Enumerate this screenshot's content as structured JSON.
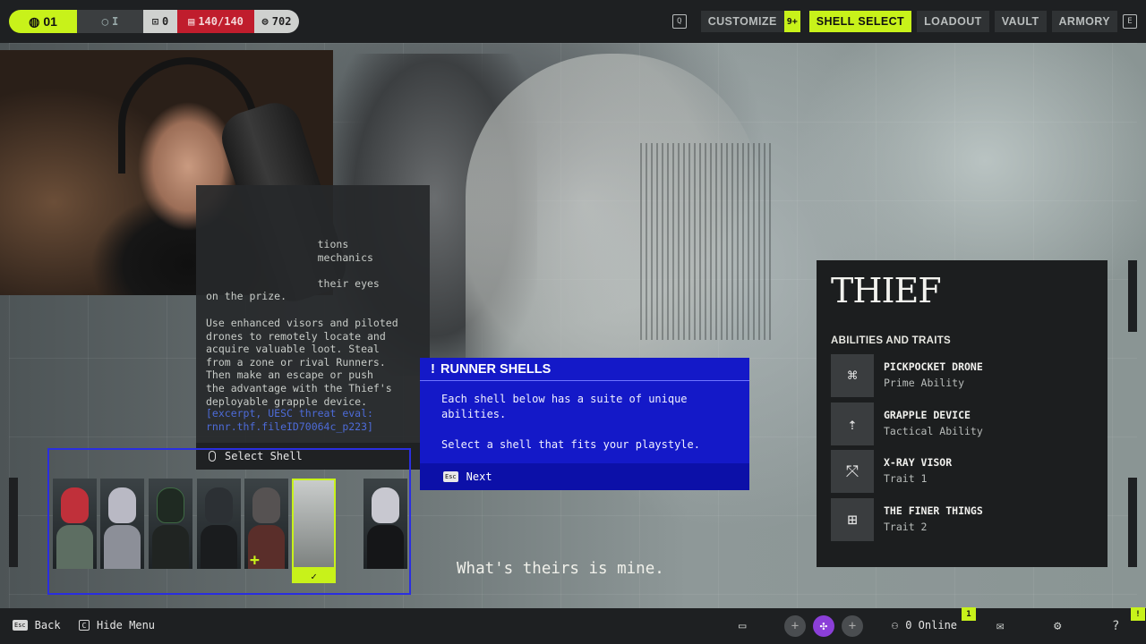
{
  "topbar": {
    "level": "01",
    "prestige": "I",
    "shields": "0",
    "health": "140/140",
    "credits": "702",
    "nav": {
      "customize": "CUSTOMIZE",
      "customize_badge": "9+",
      "shell_select": "SHELL SELECT",
      "loadout": "LOADOUT",
      "vault": "VAULT",
      "armory": "ARMORY"
    },
    "key_left": "Q",
    "key_right": "E"
  },
  "description": {
    "partial_lines": "                  tions\n                  mechanics\n\n                  their eyes\non the prize.",
    "body": "Use enhanced visors and piloted\ndrones to remotely locate and\nacquire valuable loot. Steal\nfrom a zone or rival Runners.\nThen make an escape or push\nthe advantage with the Thief's\ndeployable grapple device.",
    "meta": "[excerpt, UESC threat eval:\nrnnr.thf.fileID70064c_p223]",
    "footer_label": "Select Shell"
  },
  "tooltip": {
    "title": "RUNNER SHELLS",
    "body": "Each shell below has a suite of unique\nabilities.\n\nSelect a shell that fits your playstyle.",
    "key": "Esc",
    "next_label": "Next"
  },
  "shells": [
    {
      "id": "shell-1",
      "color": "#c0303a"
    },
    {
      "id": "shell-2",
      "color": "#b9b9c4"
    },
    {
      "id": "shell-3",
      "color": "#1f2a22"
    },
    {
      "id": "shell-4",
      "color": "#2c3034"
    },
    {
      "id": "shell-5",
      "color": "#565252"
    },
    {
      "id": "shell-6-thief",
      "color": "#b7bab8",
      "selected": true
    },
    {
      "id": "shell-7",
      "color": "#c8c8d0"
    }
  ],
  "shell_check": "✓",
  "thief": {
    "title": "THIEF",
    "subtitle": "ABILITIES AND TRAITS",
    "abilities": [
      {
        "name": "PICKPOCKET DRONE",
        "type": "Prime Ability",
        "icon": "drone-icon",
        "glyph": "⌘"
      },
      {
        "name": "GRAPPLE DEVICE",
        "type": "Tactical Ability",
        "icon": "grapple-icon",
        "glyph": "⇡"
      },
      {
        "name": "X-RAY VISOR",
        "type": "Trait 1",
        "icon": "visor-icon",
        "glyph": "⤧"
      },
      {
        "name": "THE FINER THINGS",
        "type": "Trait 2",
        "icon": "finer-things-icon",
        "glyph": "⊞"
      }
    ]
  },
  "tagline": "What's theirs is mine.",
  "bottombar": {
    "back_key": "Esc",
    "back_label": "Back",
    "hide_key": "C",
    "hide_label": "Hide Menu",
    "online_label": "0 Online",
    "online_badge": "1",
    "help_label": "?",
    "corner_badge": "!"
  },
  "colors": {
    "accent": "#c8f21a",
    "tooltip_blue": "#1419c8",
    "health_red": "#c01d2d"
  }
}
